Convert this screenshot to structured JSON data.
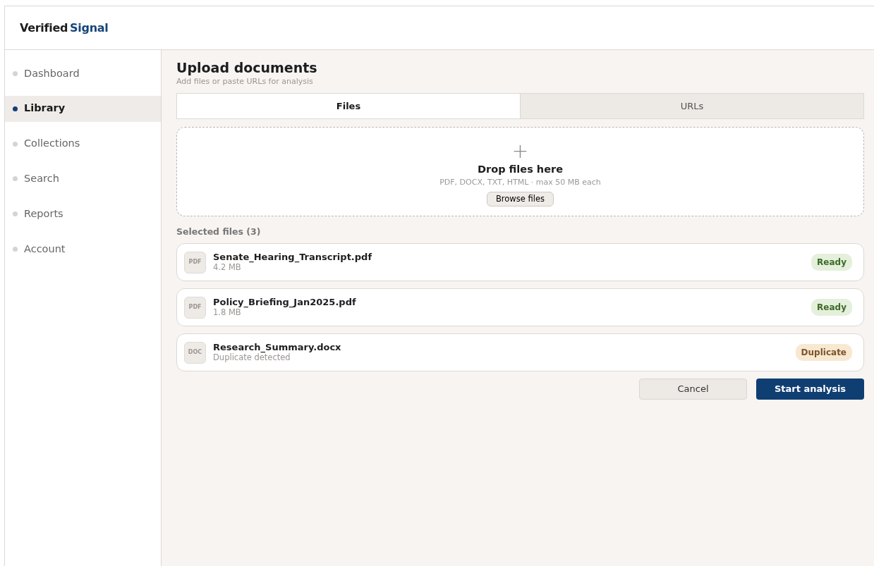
{
  "brand": {
    "first": "Verified",
    "second": "Signal"
  },
  "sidebar": {
    "items": [
      {
        "label": "Dashboard",
        "selected": false
      },
      {
        "label": "Library",
        "selected": true
      },
      {
        "label": "Collections",
        "selected": false
      },
      {
        "label": "Search",
        "selected": false
      },
      {
        "label": "Reports",
        "selected": false
      },
      {
        "label": "Account",
        "selected": false
      }
    ]
  },
  "page": {
    "title": "Upload documents",
    "subtitle": "Add files or paste URLs for analysis"
  },
  "tabs": [
    {
      "label": "Files",
      "selected": true
    },
    {
      "label": "URLs",
      "selected": false
    }
  ],
  "dropzone": {
    "icon": "+",
    "title": "Drop files here",
    "hint": "PDF, DOCX, TXT, HTML · max 50 MB each",
    "button": "Browse files"
  },
  "files_heading": "Selected files (3)",
  "files": [
    {
      "type": "PDF",
      "name": "Senate_Hearing_Transcript.pdf",
      "detail": "4.2 MB",
      "status": "Ready",
      "kind": "ready"
    },
    {
      "type": "PDF",
      "name": "Policy_Briefing_Jan2025.pdf",
      "detail": "1.8 MB",
      "status": "Ready",
      "kind": "ready"
    },
    {
      "type": "DOC",
      "name": "Research_Summary.docx",
      "detail": "Duplicate detected",
      "status": "Duplicate",
      "kind": "duplicate"
    }
  ],
  "buttons": {
    "cancel": "Cancel",
    "submit": "Start analysis"
  }
}
